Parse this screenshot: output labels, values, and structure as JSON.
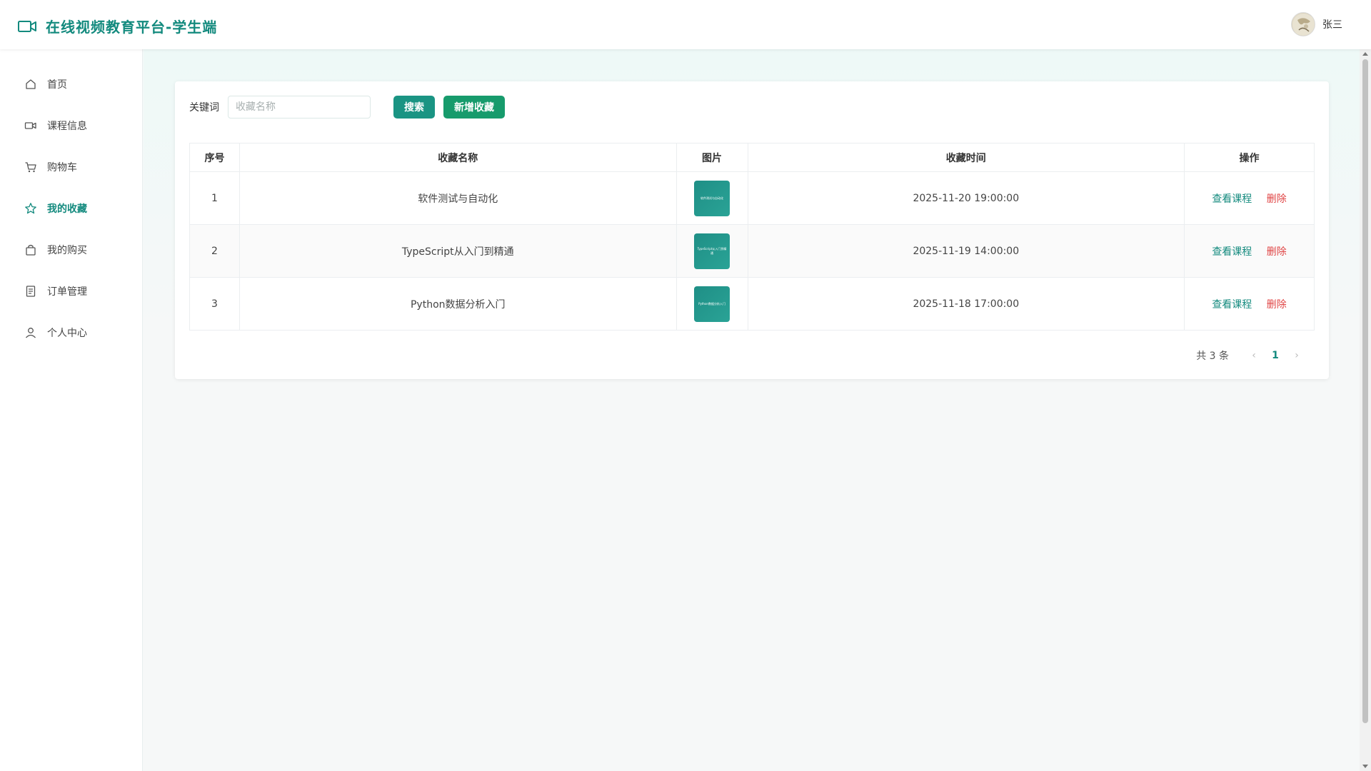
{
  "header": {
    "title": "在线视频教育平台-学生端",
    "user_name": "张三"
  },
  "sidebar": {
    "items": [
      {
        "label": "首页",
        "icon": "home-icon"
      },
      {
        "label": "课程信息",
        "icon": "video-icon"
      },
      {
        "label": "购物车",
        "icon": "cart-icon"
      },
      {
        "label": "我的收藏",
        "icon": "star-icon",
        "active": true
      },
      {
        "label": "我的购买",
        "icon": "bag-icon"
      },
      {
        "label": "订单管理",
        "icon": "document-icon"
      },
      {
        "label": "个人中心",
        "icon": "user-icon"
      }
    ]
  },
  "search": {
    "label": "关键词",
    "placeholder": "收藏名称",
    "value": "",
    "search_button": "搜索",
    "add_button": "新增收藏"
  },
  "table": {
    "columns": [
      "序号",
      "收藏名称",
      "图片",
      "收藏时间",
      "操作"
    ],
    "rows": [
      {
        "index": "1",
        "name": "软件测试与自动化",
        "image_text": "软件测试与自动化",
        "time": "2025-11-20 19:00:00"
      },
      {
        "index": "2",
        "name": "TypeScript从入门到精通",
        "image_text": "TypeScript从入门到精通",
        "time": "2025-11-19 14:00:00"
      },
      {
        "index": "3",
        "name": "Python数据分析入门",
        "image_text": "Python数据分析入门",
        "time": "2025-11-18 17:00:00"
      }
    ],
    "actions": {
      "view": "查看课程",
      "delete": "删除"
    }
  },
  "pagination": {
    "total_text": "共 3 条",
    "current_page": "1",
    "prev_icon": "‹",
    "next_icon": "›"
  },
  "colors": {
    "primary": "#138a7e",
    "button_search": "#1a9483",
    "button_add": "#179b6c",
    "danger": "#e04545"
  }
}
